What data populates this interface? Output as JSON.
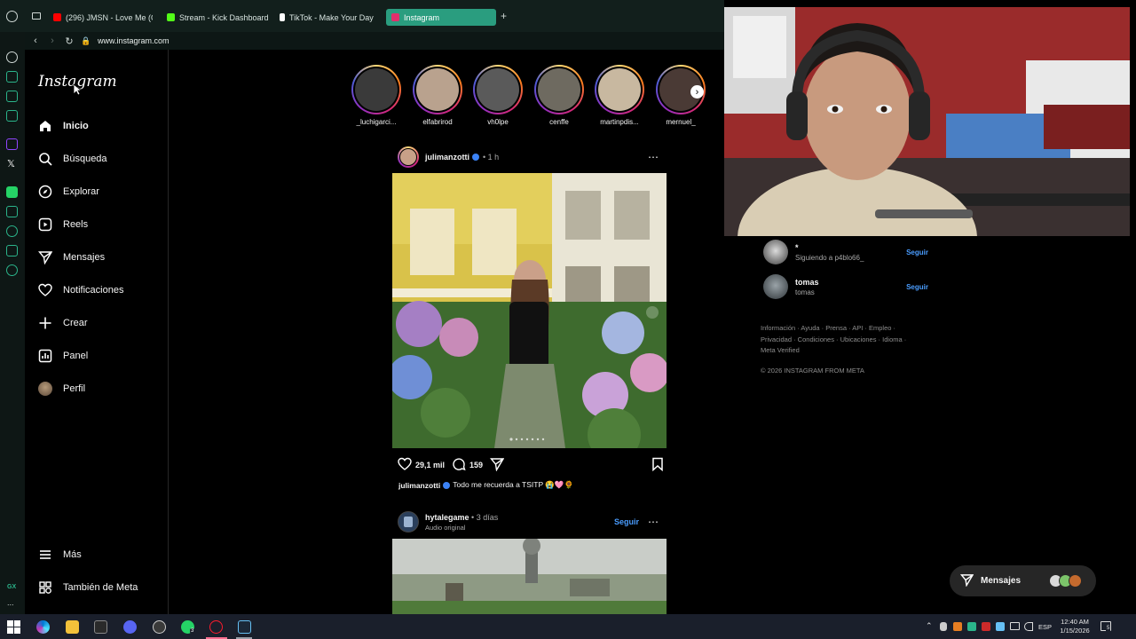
{
  "browser": {
    "tabs": [
      {
        "label": "(296) JMSN - Love Me (O",
        "favicon_color": "#ff0000",
        "active": false
      },
      {
        "label": "Stream - Kick Dashboard",
        "favicon_color": "#53fc18",
        "active": false
      },
      {
        "label": "TikTok - Make Your Day",
        "favicon_color": "#ffffff",
        "active": false
      },
      {
        "label": "Instagram",
        "favicon_color": "#e1306c",
        "active": true
      }
    ],
    "new_tab_label": "+",
    "url": "www.instagram.com",
    "side_rail_bottom_label": "GX",
    "side_rail_more": "..."
  },
  "instagram": {
    "logo": "Instagram",
    "nav": [
      {
        "label": "Inicio",
        "icon": "home-icon",
        "active": true
      },
      {
        "label": "Búsqueda",
        "icon": "search-icon",
        "active": false
      },
      {
        "label": "Explorar",
        "icon": "compass-icon",
        "active": false
      },
      {
        "label": "Reels",
        "icon": "reels-icon",
        "active": false
      },
      {
        "label": "Mensajes",
        "icon": "send-icon",
        "active": false
      },
      {
        "label": "Notificaciones",
        "icon": "heart-icon",
        "active": false
      },
      {
        "label": "Crear",
        "icon": "plus-icon",
        "active": false
      },
      {
        "label": "Panel",
        "icon": "chart-icon",
        "active": false
      },
      {
        "label": "Perfil",
        "icon": "avatar-icon",
        "active": false
      }
    ],
    "nav_bottom": [
      {
        "label": "Más",
        "icon": "menu-icon"
      },
      {
        "label": "También de Meta",
        "icon": "meta-icon"
      }
    ],
    "stories": [
      {
        "name": "_luchigarci...",
        "color": "#3a3a3a"
      },
      {
        "name": "elfabrirod",
        "color": "#b9a28e"
      },
      {
        "name": "vh0lpe",
        "color": "#5a5a5a"
      },
      {
        "name": "cenffe",
        "color": "#6e6a60"
      },
      {
        "name": "martinpdis...",
        "color": "#c8b8a0"
      },
      {
        "name": "mernuel_",
        "color": "#4a3a35"
      }
    ],
    "post1": {
      "username": "julimanzotti",
      "time": "• 1 h",
      "likes": "29,1 mil",
      "comments": "159",
      "caption_user": "julimanzotti",
      "caption_text": "Todo me recuerda a TSITP 😭🩷🌻"
    },
    "post2": {
      "username": "hytalegame",
      "time": "• 3 días",
      "subtitle": "Audio original",
      "follow": "Seguir"
    },
    "suggestions": [
      {
        "name": "*",
        "sub": "Siguiendo a p4blo66_",
        "follow": "Seguir"
      },
      {
        "name": "tomas",
        "sub": "tomas",
        "follow": "Seguir"
      }
    ],
    "footer_links": "Información · Ayuda · Prensa · API · Empleo · Privacidad · Condiciones · Ubicaciones · Idioma · Meta Verified",
    "copyright": "© 2026 INSTAGRAM FROM META",
    "messages_pill": "Mensajes"
  },
  "taskbar": {
    "language": "ESP",
    "time": "12:40 AM",
    "date": "1/15/2026",
    "notification_count": "5",
    "whatsapp_badge": "3"
  }
}
